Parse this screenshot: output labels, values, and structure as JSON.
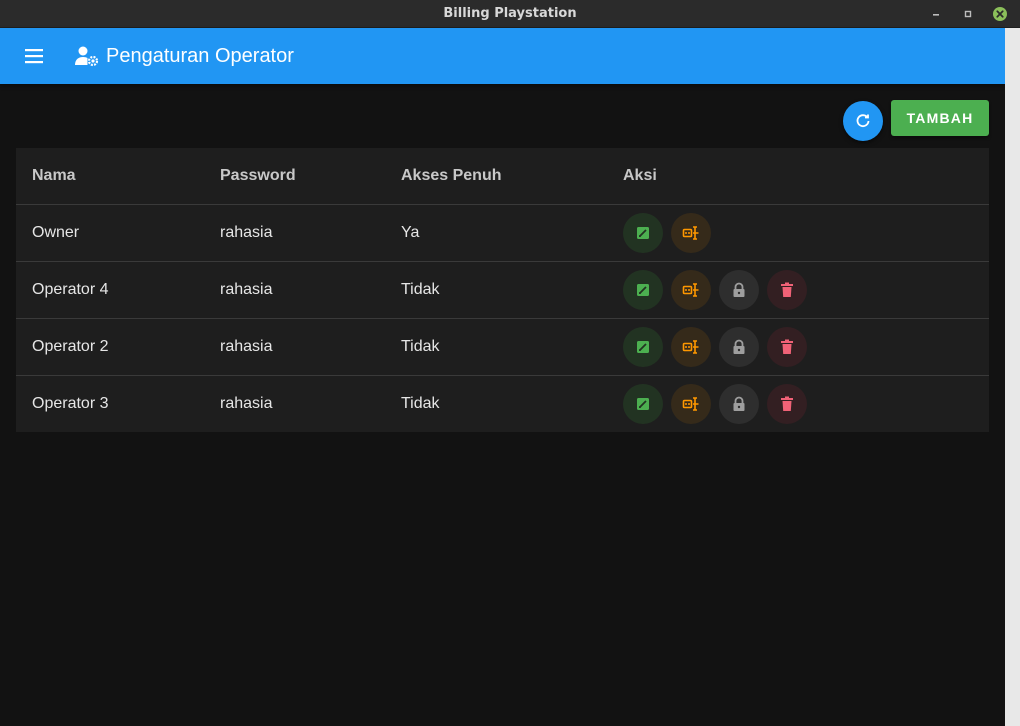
{
  "window": {
    "title": "Billing Playstation"
  },
  "appbar": {
    "title": "Pengaturan Operator",
    "menu_icon": "hamburger-menu-icon",
    "title_icon": "user-gear-icon"
  },
  "toolbar": {
    "refresh_icon": "refresh-icon",
    "add_label": "TAMBAH"
  },
  "table": {
    "headers": [
      "Nama",
      "Password",
      "Akses Penuh",
      "Aksi"
    ],
    "rows": [
      {
        "name": "Owner",
        "password": "rahasia",
        "full_access": "Ya",
        "actions": [
          "edit",
          "key"
        ]
      },
      {
        "name": "Operator 4",
        "password": "rahasia",
        "full_access": "Tidak",
        "actions": [
          "edit",
          "key",
          "lock",
          "delete"
        ]
      },
      {
        "name": "Operator 2",
        "password": "rahasia",
        "full_access": "Tidak",
        "actions": [
          "edit",
          "key",
          "lock",
          "delete"
        ]
      },
      {
        "name": "Operator 3",
        "password": "rahasia",
        "full_access": "Tidak",
        "actions": [
          "edit",
          "key",
          "lock",
          "delete"
        ]
      }
    ]
  },
  "colors": {
    "primary": "#2196f3",
    "success": "#4caf50",
    "edit": "#4caf50",
    "key": "#ff9800",
    "lock": "#9e9e9e",
    "delete": "#f06277",
    "background": "#121212",
    "surface": "#1e1e1e"
  }
}
